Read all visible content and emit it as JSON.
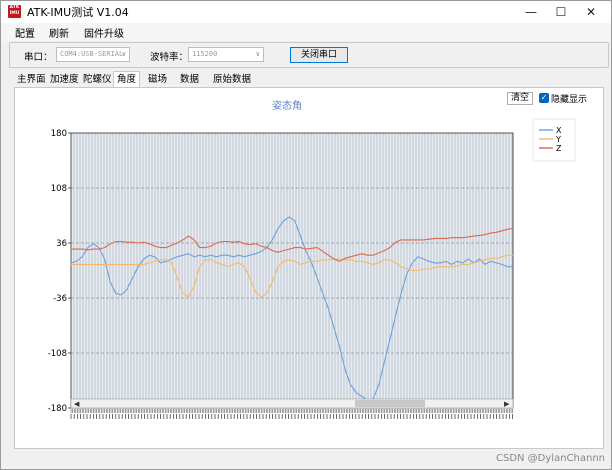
{
  "window": {
    "title": "ATK-IMU测试 V1.04",
    "logo_text": [
      "ATK",
      "IMU"
    ],
    "minimize_icon": "minimize-icon",
    "maximize_icon": "maximize-icon",
    "close_icon": "close-icon"
  },
  "menu": [
    "配置",
    "刷新",
    "固件升级"
  ],
  "serial": {
    "port_label": "串口：",
    "port_value": "COM4:USB-SERIAL",
    "baud_label": "波特率：",
    "baud_value": "115200",
    "close_button": "关闭串口"
  },
  "tabs": [
    {
      "label": "主界面",
      "active": false
    },
    {
      "label": "加速度",
      "active": false
    },
    {
      "label": "陀螺仪",
      "active": false
    },
    {
      "label": "角度",
      "active": true
    },
    {
      "label": "磁场",
      "active": false
    },
    {
      "label": "数据",
      "active": false
    },
    {
      "label": "原始数据",
      "active": false
    }
  ],
  "controls": {
    "clear_button": "清空",
    "hide_checkbox_label": "隐藏显示",
    "hide_checked": true
  },
  "watermark": "CSDN @DylanChannn",
  "chart_data": {
    "type": "line",
    "title": "姿态角",
    "xlabel": "",
    "ylabel": "",
    "ylim": [
      -180,
      180
    ],
    "yticks": [
      180,
      108,
      36,
      -36,
      -108,
      -180
    ],
    "grid": true,
    "legend_position": "top-right",
    "x_count": 80,
    "series": [
      {
        "name": "X",
        "color": "#6fa0dc",
        "values": [
          10,
          12,
          18,
          30,
          35,
          30,
          15,
          -15,
          -30,
          -32,
          -25,
          -10,
          5,
          15,
          20,
          18,
          10,
          12,
          15,
          18,
          20,
          22,
          18,
          20,
          18,
          20,
          18,
          20,
          20,
          18,
          20,
          18,
          20,
          22,
          25,
          30,
          40,
          55,
          65,
          70,
          65,
          45,
          25,
          10,
          -10,
          -30,
          -50,
          -75,
          -100,
          -130,
          -150,
          -160,
          -165,
          -170,
          -168,
          -150,
          -120,
          -90,
          -60,
          -30,
          -5,
          10,
          18,
          15,
          12,
          10,
          10,
          12,
          8,
          12,
          10,
          15,
          10,
          15,
          8,
          12,
          10,
          8,
          5,
          5
        ]
      },
      {
        "name": "Y",
        "color": "#f5b96b",
        "values": [
          8,
          8,
          8,
          8,
          8,
          8,
          8,
          8,
          8,
          8,
          8,
          8,
          8,
          8,
          10,
          12,
          14,
          14,
          10,
          -10,
          -30,
          -35,
          -20,
          5,
          14,
          14,
          10,
          8,
          5,
          8,
          10,
          5,
          -10,
          -28,
          -35,
          -30,
          -15,
          5,
          12,
          14,
          12,
          8,
          10,
          12,
          12,
          14,
          14,
          15,
          15,
          14,
          14,
          12,
          12,
          10,
          8,
          10,
          14,
          14,
          10,
          5,
          2,
          0,
          0,
          2,
          2,
          4,
          5,
          5,
          5,
          6,
          8,
          8,
          10,
          12,
          14,
          16,
          16,
          18,
          20,
          20
        ]
      },
      {
        "name": "Z",
        "color": "#d96a4d",
        "values": [
          28,
          28,
          28,
          27,
          28,
          28,
          30,
          35,
          38,
          38,
          37,
          37,
          36,
          37,
          35,
          32,
          30,
          30,
          33,
          36,
          40,
          45,
          40,
          30,
          30,
          32,
          36,
          38,
          38,
          37,
          38,
          35,
          34,
          35,
          32,
          30,
          26,
          24,
          26,
          28,
          30,
          30,
          28,
          29,
          30,
          25,
          20,
          15,
          12,
          16,
          18,
          20,
          22,
          20,
          20,
          23,
          26,
          30,
          37,
          40,
          40,
          40,
          40,
          40,
          41,
          42,
          42,
          42,
          43,
          43,
          43,
          44,
          45,
          46,
          47,
          49,
          50,
          52,
          54,
          55
        ]
      }
    ]
  }
}
